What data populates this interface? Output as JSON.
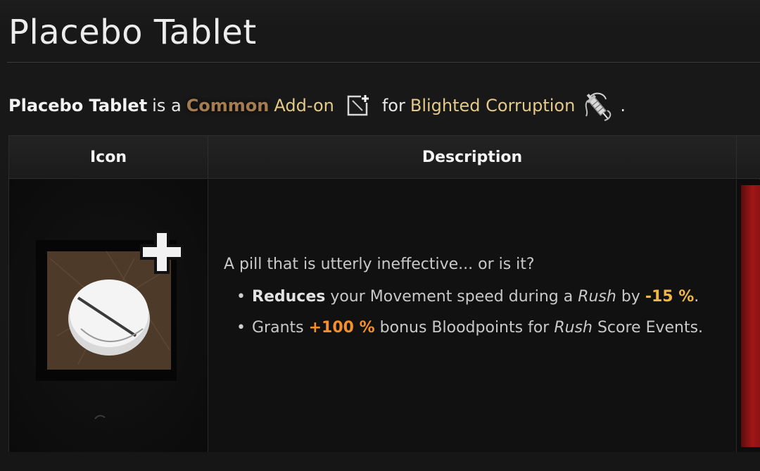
{
  "page": {
    "title": "Placebo Tablet"
  },
  "intro": {
    "item_name": "Placebo Tablet",
    "is_a": "is a",
    "rarity": "Common",
    "type": "Add-on",
    "for": "for",
    "power": "Blighted Corruption",
    "period": ".",
    "addon_icon": "addon-square-plus-icon",
    "power_icon": "blighted-corruption-syringe-icon"
  },
  "table": {
    "headers": [
      "Icon",
      "Description"
    ],
    "icon_cell": {
      "image": "placebo-tablet-pill-icon",
      "badge": "plus-icon"
    },
    "description": {
      "intro": "A pill that is utterly ineffective... or is it?",
      "bullets": [
        {
          "bold": "Reduces",
          "text1": " your Movement speed during a ",
          "italic": "Rush",
          "text2": " by ",
          "value": "-15 %",
          "text3": "."
        },
        {
          "lead": "Grants ",
          "value": "+100 %",
          "text1": " bonus Bloodpoints for ",
          "italic": "Rush",
          "text2": " Score Events."
        }
      ]
    }
  },
  "colors": {
    "rarity_common": "#a57c4f",
    "link_gold": "#e3c98a",
    "negative_value": "#f0b548",
    "positive_value": "#f4902b",
    "addon_background": "#4e3a28"
  }
}
